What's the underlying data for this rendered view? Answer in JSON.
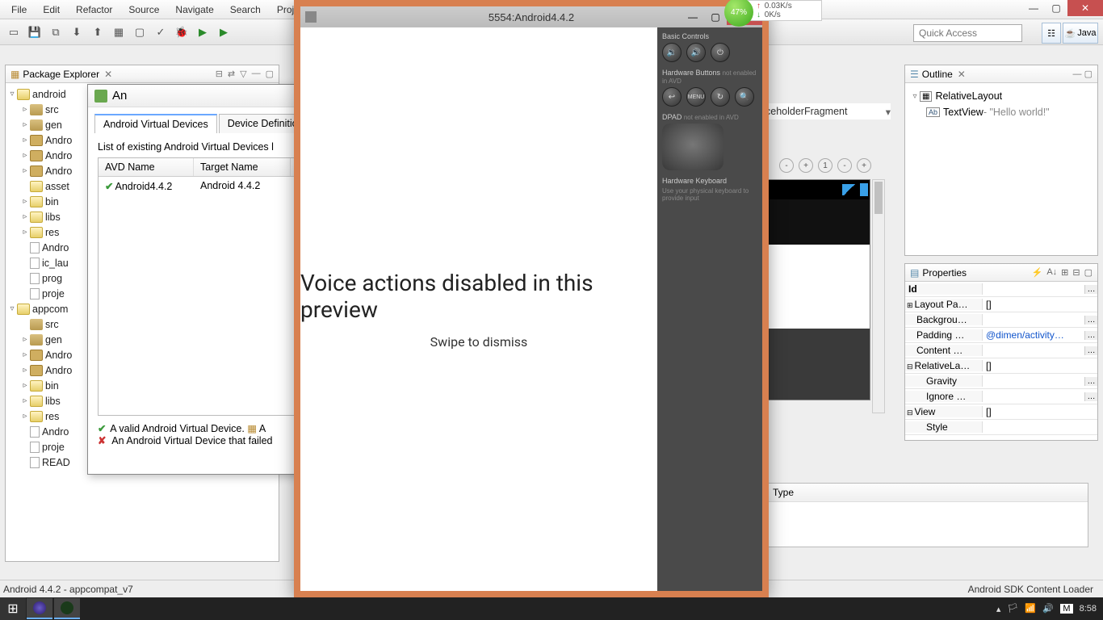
{
  "menubar": [
    "File",
    "Edit",
    "Refactor",
    "Source",
    "Navigate",
    "Search",
    "Project"
  ],
  "quick_access_placeholder": "Quick Access",
  "perspective": {
    "java_label": "Java"
  },
  "statusbar": {
    "left": "Android 4.4.2 - appcompat_v7",
    "right": "Android SDK Content Loader"
  },
  "pkg_explorer": {
    "title": "Package Explorer",
    "projects": [
      {
        "name": "android",
        "children": [
          "src",
          "gen",
          "Andro",
          "Andro",
          "Andro",
          "asset",
          "bin",
          "libs",
          "res",
          "Andro",
          "ic_lau",
          "prog",
          "proje"
        ]
      },
      {
        "name": "appcom",
        "children": [
          "src",
          "gen",
          "Andro",
          "Andro",
          "bin",
          "libs",
          "res",
          "Andro",
          "proje",
          "READ"
        ]
      }
    ]
  },
  "avd": {
    "title": "An",
    "tabs": [
      "Android Virtual Devices",
      "Device Definitio"
    ],
    "list_label": "List of existing Android Virtual Devices l",
    "columns": [
      "AVD Name",
      "Target Name"
    ],
    "rows": [
      {
        "name": "Android4.4.2",
        "target": "Android 4.4.2"
      }
    ],
    "legend_valid": "A valid Android Virtual Device.",
    "legend_icon2": "A",
    "legend_failed": "An Android Virtual Device that failed"
  },
  "editor": {
    "fragment_label": "ceholderFragment",
    "zoom_labels": [
      "-",
      "+",
      "1",
      "-",
      "+"
    ]
  },
  "outline": {
    "title": "Outline",
    "rows": [
      {
        "indent": 0,
        "tw": "▿",
        "icon": "▢",
        "text": "RelativeLayout"
      },
      {
        "indent": 1,
        "tw": "",
        "icon": "Ab",
        "text": "TextView",
        "suffix": " - \"Hello world!\""
      }
    ]
  },
  "properties": {
    "title": "Properties",
    "rows": [
      {
        "k": "Id",
        "v": "",
        "btn": true,
        "header": true
      },
      {
        "k": "Layout Pa…",
        "v": "[]",
        "expander": "⊞"
      },
      {
        "k": "Backgrou…",
        "v": "",
        "btn": true
      },
      {
        "k": "Padding …",
        "v": "@dimen/activity…",
        "btn": true,
        "link": true
      },
      {
        "k": "Content …",
        "v": "",
        "btn": true
      },
      {
        "k": "RelativeLa…",
        "v": "[]",
        "expander": "⊟"
      },
      {
        "k": "Gravity",
        "v": "",
        "btn": true,
        "indent": true
      },
      {
        "k": "Ignore …",
        "v": "",
        "btn": true,
        "indent": true
      },
      {
        "k": "View",
        "v": "[]",
        "expander": "⊟"
      },
      {
        "k": "Style",
        "v": "",
        "indent": true
      }
    ]
  },
  "type_panel": {
    "header": "Type"
  },
  "net": {
    "percent": "47%",
    "up": "0.03K/s",
    "down": "0K/s"
  },
  "emulator": {
    "title": "5554:Android4.4.2",
    "msg1": "Voice actions disabled in this preview",
    "msg2": "Swipe to dismiss",
    "side": {
      "basic": "Basic Controls",
      "hw_buttons": "Hardware Buttons",
      "hw_sub": "not enabled in AVD",
      "dpad": "DPAD",
      "dpad_sub": "not enabled in AVD",
      "kbd": "Hardware Keyboard",
      "kbd_sub": "Use your physical keyboard to provide input"
    }
  },
  "taskbar": {
    "clock": "8:58",
    "ime": "M"
  }
}
